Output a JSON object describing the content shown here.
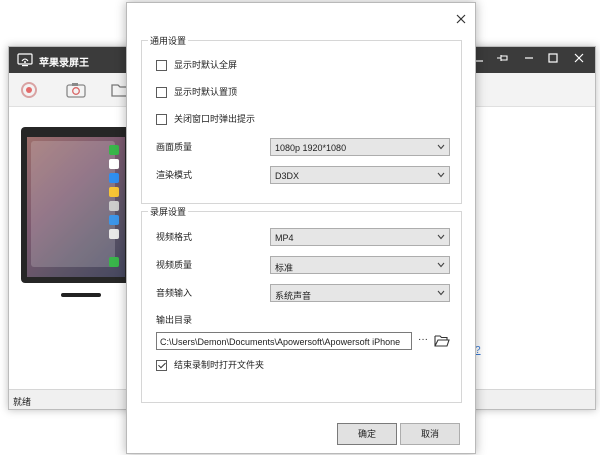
{
  "main_window": {
    "title": "苹果录屏王",
    "status": "就绪",
    "help_link": "?",
    "window_buttons": [
      "minimize-icon",
      "pin-icon",
      "minimize-icon",
      "maximize-icon",
      "close-icon"
    ]
  },
  "dialog": {
    "general": {
      "title": "通用设置",
      "options": [
        {
          "label": "显示时默认全屏",
          "checked": false
        },
        {
          "label": "显示时默认置顶",
          "checked": false
        },
        {
          "label": "关闭窗口时弹出提示",
          "checked": false
        }
      ],
      "quality_label": "画面质量",
      "quality_value": "1080p 1920*1080",
      "render_label": "渲染模式",
      "render_value": "D3DX"
    },
    "recording": {
      "title": "录屏设置",
      "format_label": "视频格式",
      "format_value": "MP4",
      "vquality_label": "视频质量",
      "vquality_value": "标准",
      "audio_label": "音频输入",
      "audio_value": "系统声音",
      "output_label": "输出目录",
      "output_path": "C:\\Users\\Demon\\Documents\\Apowersoft\\Apowersoft iPhone",
      "browse_label": "···",
      "open_folder_option": {
        "label": "结束录制时打开文件夹",
        "checked": true
      }
    },
    "ok_label": "确定",
    "cancel_label": "取消"
  }
}
